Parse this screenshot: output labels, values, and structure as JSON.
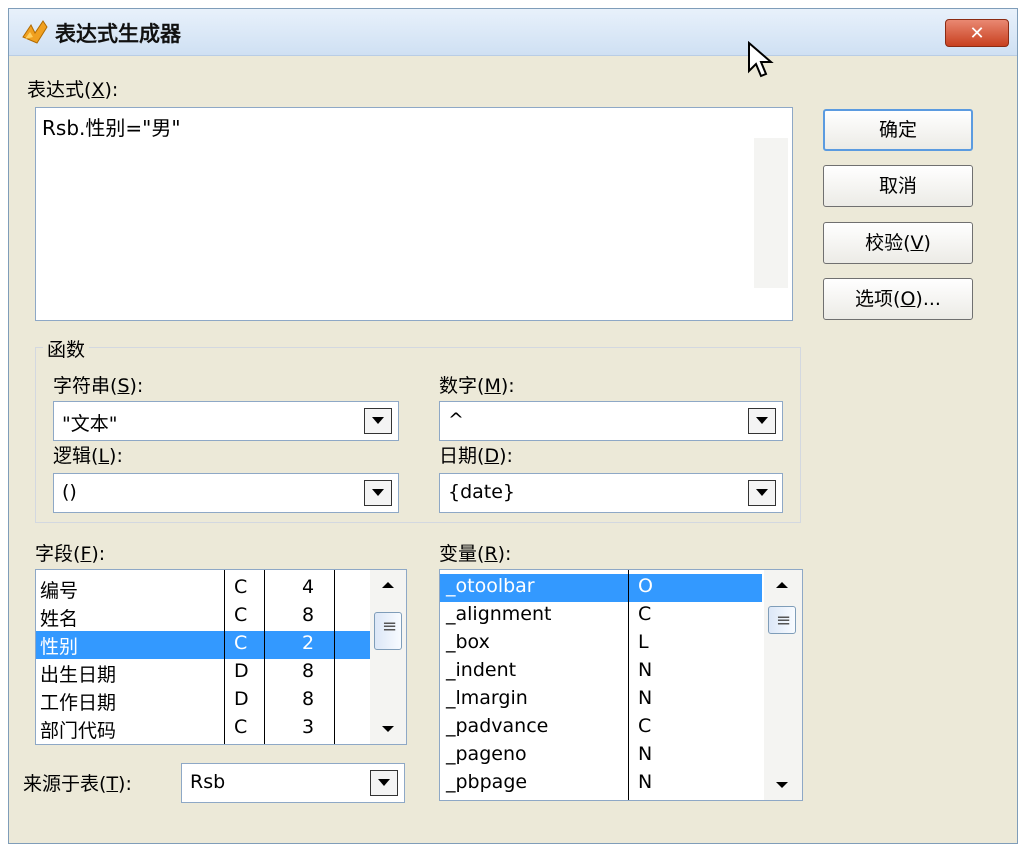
{
  "title": "表达式生成器",
  "close_label": "✕",
  "expression": {
    "label": "表达式",
    "hotkey": "X",
    "value": "Rsb.性别=\"男\""
  },
  "buttons": {
    "ok": "确定",
    "cancel": "取消",
    "verify": {
      "label": "校验",
      "hotkey": "V"
    },
    "options": {
      "label": "选项",
      "hotkey": "O",
      "suffix": "..."
    }
  },
  "functions": {
    "group_label": "函数",
    "string": {
      "label": "字符串",
      "hotkey": "S",
      "value": "\"文本\""
    },
    "math": {
      "label": "数字",
      "hotkey": "M",
      "value": "^"
    },
    "logical": {
      "label": "逻辑",
      "hotkey": "L",
      "value": "()"
    },
    "date": {
      "label": "日期",
      "hotkey": "D",
      "value": "{date}"
    }
  },
  "fields": {
    "label": "字段",
    "hotkey": "F",
    "rows": [
      {
        "name": "编号",
        "type": "C",
        "width": "4"
      },
      {
        "name": "姓名",
        "type": "C",
        "width": "8"
      },
      {
        "name": "性别",
        "type": "C",
        "width": "2",
        "selected": true
      },
      {
        "name": "出生日期",
        "type": "D",
        "width": "8"
      },
      {
        "name": "工作日期",
        "type": "D",
        "width": "8"
      },
      {
        "name": "部门代码",
        "type": "C",
        "width": "3"
      }
    ]
  },
  "variables": {
    "label": "变量",
    "hotkey": "R",
    "rows": [
      {
        "name": "_otoolbar",
        "type": "O",
        "selected": true
      },
      {
        "name": "_alignment",
        "type": "C"
      },
      {
        "name": "_box",
        "type": "L"
      },
      {
        "name": "_indent",
        "type": "N"
      },
      {
        "name": "_lmargin",
        "type": "N"
      },
      {
        "name": "_padvance",
        "type": "C"
      },
      {
        "name": "_pageno",
        "type": "N"
      },
      {
        "name": "_pbpage",
        "type": "N"
      }
    ]
  },
  "source_table": {
    "label": "来源于表",
    "hotkey": "T",
    "value": "Rsb"
  },
  "colors": {
    "selection": "#3399ff",
    "close_button": "#c8401f",
    "dialog_bg": "#ece9d8"
  }
}
